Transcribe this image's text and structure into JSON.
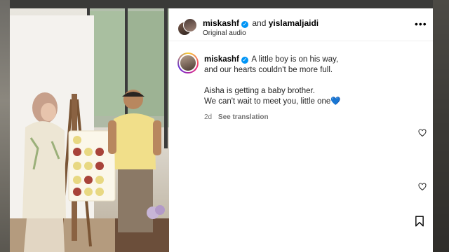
{
  "header": {
    "user1": "miskashf",
    "connector": "and",
    "user2": "yislamaljaidi",
    "audio": "Original audio",
    "more_icon": "more-horizontal-icon"
  },
  "caption": {
    "username": "miskashf",
    "line1": "A little boy is on his way,",
    "line2": "and our hearts couldn't be more full.",
    "line3": "Aisha is getting a baby brother.",
    "line4": "We can't wait to meet you, little one",
    "heart_emoji": "💙",
    "time": "2d",
    "translate": "See translation"
  },
  "photo": {
    "board_text": "...",
    "icons": [
      "heart-outline-icon",
      "bookmark-icon"
    ]
  },
  "colors": {
    "verified": "#0095f6",
    "text": "#262626",
    "muted": "#737373"
  }
}
